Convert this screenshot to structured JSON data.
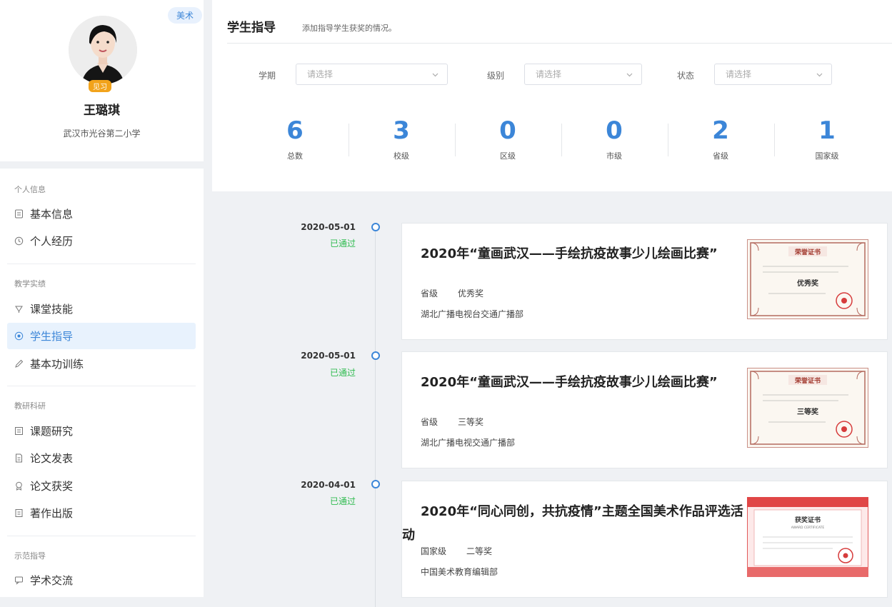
{
  "profile": {
    "subject_badge": "美术",
    "intern_badge": "见习",
    "name": "王璐琪",
    "school": "武汉市光谷第二小学"
  },
  "nav": {
    "sections": [
      {
        "title": "个人信息",
        "items": [
          {
            "label": "基本信息",
            "icon": "document-icon"
          },
          {
            "label": "个人经历",
            "icon": "clock-icon"
          }
        ]
      },
      {
        "title": "教学实绩",
        "items": [
          {
            "label": "课堂技能",
            "icon": "trophy-icon"
          },
          {
            "label": "学生指导",
            "icon": "palette-icon",
            "active": true
          },
          {
            "label": "基本功训练",
            "icon": "pencil-icon"
          }
        ]
      },
      {
        "title": "教研科研",
        "items": [
          {
            "label": "课题研究",
            "icon": "list-icon"
          },
          {
            "label": "论文发表",
            "icon": "file-icon"
          },
          {
            "label": "论文获奖",
            "icon": "medal-icon"
          },
          {
            "label": "著作出版",
            "icon": "book-icon"
          }
        ]
      },
      {
        "title": "示范指导",
        "items": [
          {
            "label": "学术交流",
            "icon": "chat-icon"
          }
        ]
      }
    ]
  },
  "page": {
    "title": "学生指导",
    "description": "添加指导学生获奖的情况。"
  },
  "filters": [
    {
      "label": "学期",
      "placeholder": "请选择"
    },
    {
      "label": "级别",
      "placeholder": "请选择"
    },
    {
      "label": "状态",
      "placeholder": "请选择"
    }
  ],
  "stats": [
    {
      "value": "6",
      "label": "总数"
    },
    {
      "value": "3",
      "label": "校级"
    },
    {
      "value": "0",
      "label": "区级"
    },
    {
      "value": "0",
      "label": "市级"
    },
    {
      "value": "2",
      "label": "省级"
    },
    {
      "value": "1",
      "label": "国家级"
    }
  ],
  "awards": [
    {
      "date": "2020-05-01",
      "status": "已通过",
      "title": "2020年“童画武汉——手绘抗疫故事少儿绘画比赛”",
      "level": "省级",
      "prize": "优秀奖",
      "organizer": "湖北广播电视台交通广播部",
      "cert": {
        "heading": "荣誉证书",
        "award": "优秀奖",
        "theme": "classic"
      }
    },
    {
      "date": "2020-05-01",
      "status": "已通过",
      "title": "2020年“童画武汉——手绘抗疫故事少儿绘画比赛”",
      "level": "省级",
      "prize": "三等奖",
      "organizer": "湖北广播电视交通广播部",
      "cert": {
        "heading": "荣誉证书",
        "award": "三等奖",
        "theme": "classic"
      }
    },
    {
      "date": "2020-04-01",
      "status": "已通过",
      "title": "2020年“同心同创，共抗疫情”主题全国美术作品评选活动",
      "level": "国家级",
      "prize": "二等奖",
      "organizer": "中国美术教育编辑部",
      "cert": {
        "heading": "获奖证书",
        "subheading": "AWARD CERTIFICATE",
        "theme": "red"
      }
    }
  ],
  "colors": {
    "accent": "#3c86d8",
    "status_passed": "#2fbb4f",
    "badge": "#f2a31b"
  }
}
